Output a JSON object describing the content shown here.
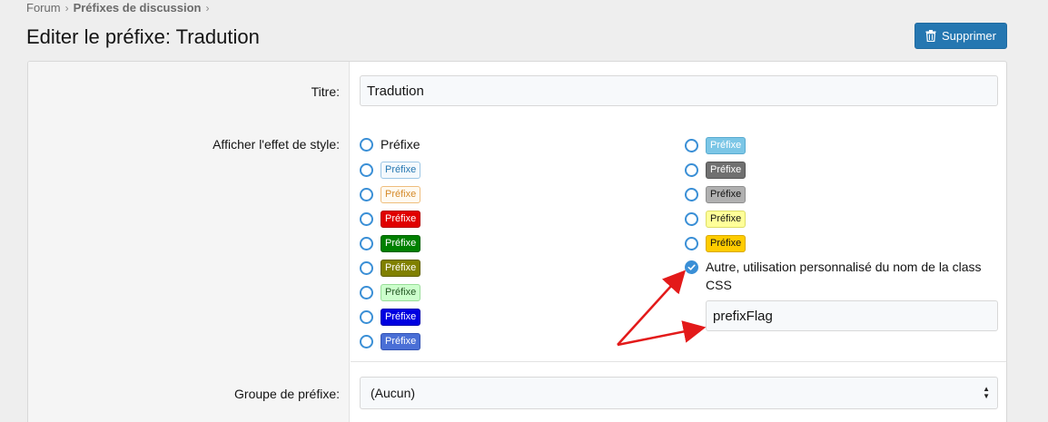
{
  "breadcrumb": {
    "items": [
      {
        "label": "Forum"
      },
      {
        "label": "Préfixes de discussion"
      }
    ],
    "separator": "›"
  },
  "page": {
    "title": "Editer le préfixe: Tradution"
  },
  "toolbar": {
    "delete_label": "Supprimer"
  },
  "form": {
    "title_label": "Titre:",
    "title_value": "Tradution",
    "style_label": "Afficher l'effet de style:",
    "group_label": "Groupe de préfixe:",
    "group_value": "(Aucun)",
    "custom_class_value": "prefixFlag",
    "style_options_left": [
      {
        "label": "Préfixe",
        "bg": "",
        "color": "#141414",
        "border": "",
        "checked": false,
        "plain": true
      },
      {
        "label": "Préfixe",
        "bg": "#f4f9fd",
        "color": "#2577b1",
        "border": "#9cc6e5",
        "checked": false
      },
      {
        "label": "Préfixe",
        "bg": "#fffaf0",
        "color": "#d58a29",
        "border": "#efbd7c",
        "checked": false
      },
      {
        "label": "Préfixe",
        "bg": "#e00000",
        "color": "#ffffff",
        "border": "#b30000",
        "checked": false
      },
      {
        "label": "Préfixe",
        "bg": "#008000",
        "color": "#ffffff",
        "border": "#006000",
        "checked": false
      },
      {
        "label": "Préfixe",
        "bg": "#808000",
        "color": "#ffffff",
        "border": "#606000",
        "checked": false
      },
      {
        "label": "Préfixe",
        "bg": "#ccffcc",
        "color": "#225522",
        "border": "#99dd99",
        "checked": false
      },
      {
        "label": "Préfixe",
        "bg": "#0000e0",
        "color": "#ffffff",
        "border": "#0000b0",
        "checked": false
      },
      {
        "label": "Préfixe",
        "bg": "#4a6fd6",
        "color": "#ffffff",
        "border": "#3454b5",
        "checked": false
      }
    ],
    "style_options_right": [
      {
        "label": "Préfixe",
        "bg": "#7bc6e6",
        "color": "#ffffff",
        "border": "#59abd0",
        "checked": false
      },
      {
        "label": "Préfixe",
        "bg": "#707070",
        "color": "#ffffff",
        "border": "#555555",
        "checked": false
      },
      {
        "label": "Préfixe",
        "bg": "#b0b0b0",
        "color": "#141414",
        "border": "#8e8e8e",
        "checked": false
      },
      {
        "label": "Préfixe",
        "bg": "#ffff99",
        "color": "#141414",
        "border": "#dddd66",
        "checked": false
      },
      {
        "label": "Préfixe",
        "bg": "#ffcc00",
        "color": "#141414",
        "border": "#d9a900",
        "checked": false
      }
    ],
    "other_option": {
      "label": "Autre, utilisation personnalisé du nom de la class CSS",
      "checked": true
    }
  },
  "colors": {
    "accent": "#2577b1",
    "radio": "#3a8fd6",
    "annotation_arrow": "#e31a1a"
  },
  "icons": {
    "delete": "trash-icon",
    "checked": "check-icon",
    "select": "select-arrows-icon"
  }
}
